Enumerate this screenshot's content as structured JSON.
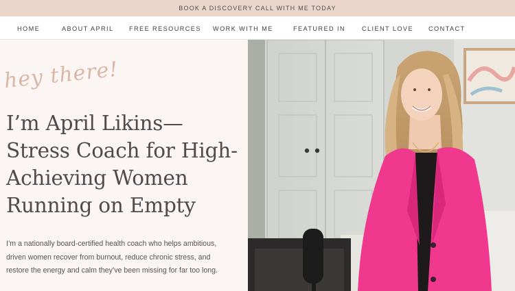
{
  "announcement": {
    "text": "BOOK A DISCOVERY CALL WITH ME TODAY"
  },
  "nav": {
    "items": [
      {
        "id": "home",
        "label": "HOME"
      },
      {
        "id": "about",
        "label": "ABOUT APRIL"
      },
      {
        "id": "resources",
        "label": "FREE RESOURCES"
      },
      {
        "id": "work",
        "label": "WORK WITH ME"
      },
      {
        "id": "featured",
        "label": "FEATURED IN"
      },
      {
        "id": "love",
        "label": "CLIENT LOVE"
      },
      {
        "id": "contact",
        "label": "CONTACT"
      }
    ]
  },
  "hero": {
    "script_greeting": "hey there!",
    "headline": [
      "I’m April Likins—",
      "Stress Coach for High-",
      "Achieving Women",
      "Running on Empty"
    ],
    "intro": [
      "I’m a nationally board-certified health coach who helps ambitious,",
      "driven women recover from burnout, reduce chronic stress, and",
      "restore the energy and calm they’ve been missing for far too long."
    ]
  },
  "colors": {
    "announcement_bg": "#ecd6cc",
    "hero_bg": "#fbf6f3",
    "script_accent": "#d9b7a8",
    "blazer_pink": "#f0388f"
  }
}
